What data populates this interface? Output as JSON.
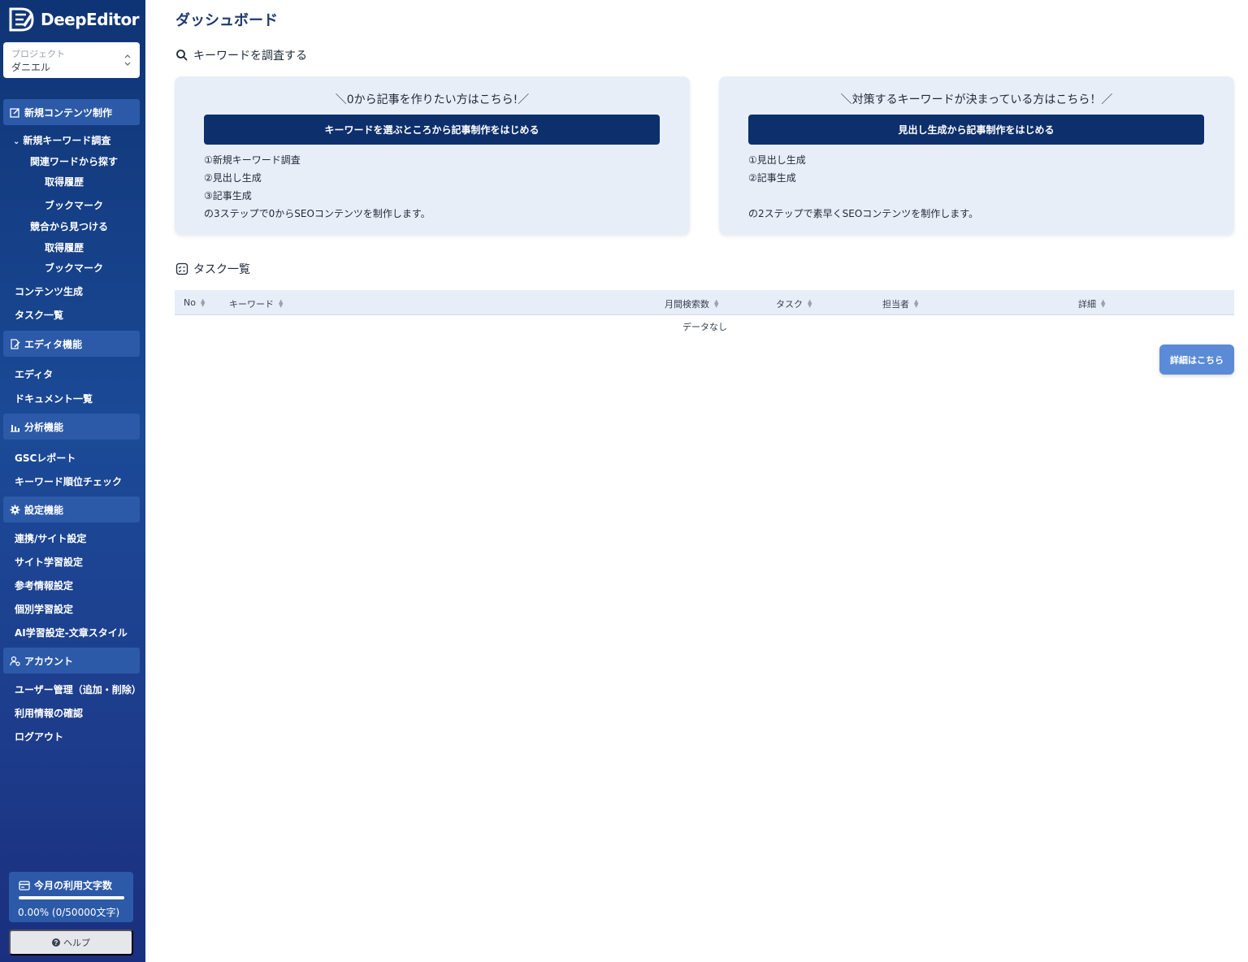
{
  "app": {
    "name": "DeepEditor"
  },
  "project": {
    "label": "プロジェクト",
    "name": "ダニエル"
  },
  "sidebar": {
    "sections": [
      {
        "label": "新規コンテンツ制作",
        "icon": "edit-square-icon"
      },
      {
        "label": "エディタ機能",
        "icon": "document-edit-icon"
      },
      {
        "label": "分析機能",
        "icon": "bar-chart-icon"
      },
      {
        "label": "設定機能",
        "icon": "gear-icon"
      },
      {
        "label": "アカウント",
        "icon": "user-settings-icon"
      }
    ],
    "content_items": {
      "keyword_research": "新規キーワード調査",
      "related_search": "関連ワードから探す",
      "related_history": "取得履歴",
      "related_bookmark": "ブックマーク",
      "competitor_search": "競合から見つける",
      "competitor_history": "取得履歴",
      "competitor_bookmark": "ブックマーク",
      "content_generation": "コンテンツ生成",
      "task_list": "タスク一覧"
    },
    "editor_items": {
      "editor": "エディタ",
      "documents": "ドキュメント一覧"
    },
    "analysis_items": {
      "gsc": "GSCレポート",
      "rank_check": "キーワード順位チェック"
    },
    "settings_items": {
      "integration": "連携/サイト設定",
      "site_learning": "サイト学習設定",
      "reference": "参考情報設定",
      "individual": "個別学習設定",
      "ai_style": "AI学習設定-文章スタイル"
    },
    "account_items": {
      "user_mgmt": "ユーザー管理（追加・削除）",
      "usage_info": "利用情報の確認",
      "logout": "ログアウト"
    },
    "usage": {
      "title": "今月の利用文字数",
      "percent": 0.0,
      "text": "0.00% (0/50000文字)"
    },
    "help_label": "ヘルプ"
  },
  "main": {
    "title": "ダッシュボード",
    "keyword_section": "キーワードを調査する",
    "cards": [
      {
        "heading": "＼0から記事を作りたい方はこちら!／",
        "button": "キーワードを選ぶところから記事制作をはじめる",
        "lines": [
          "①新規キーワード調査",
          "②見出し生成",
          "③記事生成",
          "の3ステップで0からSEOコンテンツを制作します。"
        ]
      },
      {
        "heading": "＼対策するキーワードが決まっている方はこちら！／",
        "button": "見出し生成から記事制作をはじめる",
        "lines": [
          "①見出し生成",
          "②記事生成",
          "",
          "の2ステップで素早くSEOコンテンツを制作します。"
        ]
      }
    ],
    "task_section": "タスク一覧",
    "table": {
      "columns": [
        "No",
        "キーワード",
        "月間検索数",
        "タスク",
        "担当者",
        "詳細"
      ],
      "empty_text": "データなし"
    },
    "detail_button": "詳細はこちら"
  },
  "colors": {
    "sidebar_top": "#0f3475",
    "sidebar_section": "#2c5aa8",
    "primary_button": "#0d2f6b",
    "card_bg": "#e8eef8",
    "accent": "#5b8bd6"
  }
}
